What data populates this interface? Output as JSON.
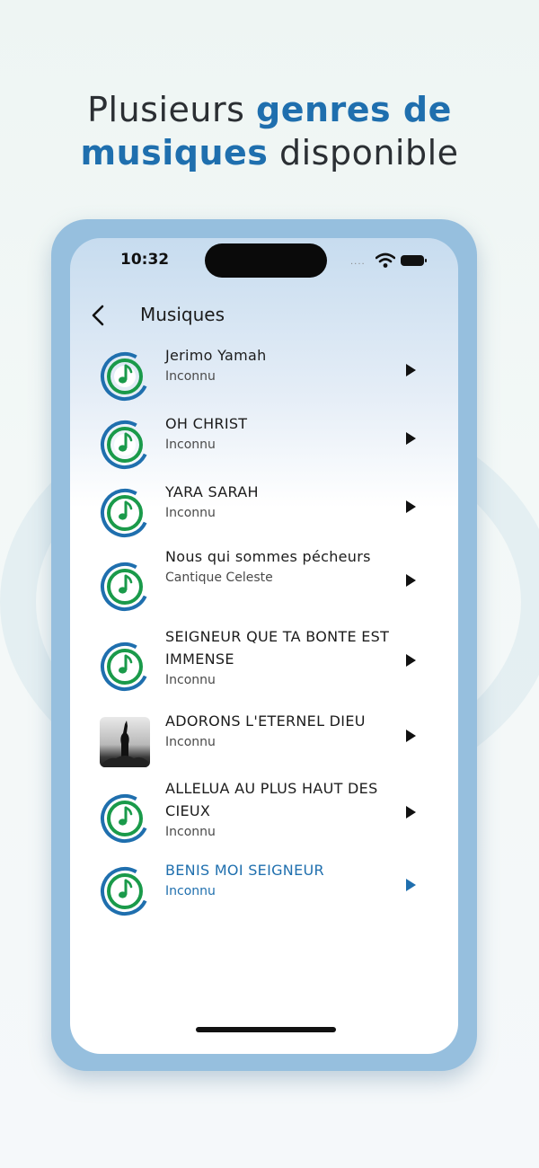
{
  "headline": {
    "part1": "Plusieurs ",
    "highlight1": "genres de",
    "highlight2": "musiques",
    "part2": " disponible"
  },
  "status_bar": {
    "time": "10:32"
  },
  "nav": {
    "title": "Musiques"
  },
  "songs": [
    {
      "title": "Jerimo Yamah",
      "artist": "Inconnu",
      "thumb": "music-note-logo",
      "active": false
    },
    {
      "title": "OH CHRIST",
      "artist": "Inconnu",
      "thumb": "music-note-logo",
      "active": false
    },
    {
      "title": "YARA SARAH",
      "artist": "Inconnu",
      "thumb": "music-note-logo",
      "active": false
    },
    {
      "title": "Nous qui sommes pécheurs",
      "artist": "Cantique Celeste",
      "thumb": "music-note-logo",
      "active": false
    },
    {
      "title": "SEIGNEUR QUE TA BONTE EST IMMENSE",
      "artist": "Inconnu",
      "thumb": "music-note-logo",
      "active": false
    },
    {
      "title": "ADORONS L'ETERNEL DIEU",
      "artist": "Inconnu",
      "thumb": "worship-photo",
      "active": false
    },
    {
      "title": "ALLELUA AU PLUS HAUT DES CIEUX",
      "artist": "Inconnu",
      "thumb": "music-note-logo",
      "active": false
    },
    {
      "title": "BENIS MOI SEIGNEUR",
      "artist": "Inconnu",
      "thumb": "music-note-logo",
      "active": true
    }
  ],
  "colors": {
    "accent": "#1f6fae",
    "logo_green": "#1a9a4a",
    "logo_blue": "#1f6fae",
    "phone_frame": "#96bfde"
  }
}
